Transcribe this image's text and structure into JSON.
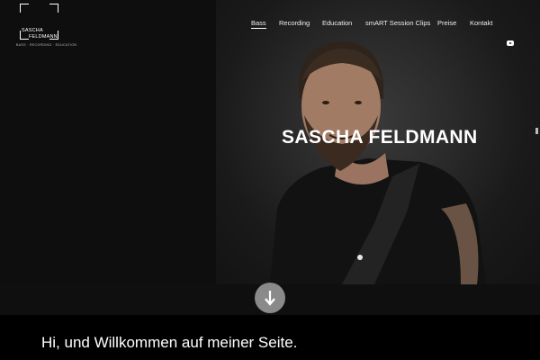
{
  "logo": {
    "line1": "SASCHA",
    "line2": "FELDMANN",
    "tagline": "BASS · RECORDING · EDUCATION"
  },
  "nav": {
    "items": [
      {
        "label": "Bass",
        "active": true
      },
      {
        "label": "Recording"
      },
      {
        "label": "Education"
      },
      {
        "label": "smART Session Clips"
      },
      {
        "label": "Preise"
      },
      {
        "label": "Kontakt"
      }
    ],
    "social_icon": "youtube-icon"
  },
  "hero": {
    "title": "SASCHA FELDMANN",
    "scroll_icon": "arrow-down-icon"
  },
  "welcome": {
    "text": "Hi, und Willkommen auf meiner Seite."
  },
  "colors": {
    "background": "#0d0d0d",
    "text": "#ffffff",
    "scroll_button": "#8a8a8a",
    "bar": "#000000"
  }
}
